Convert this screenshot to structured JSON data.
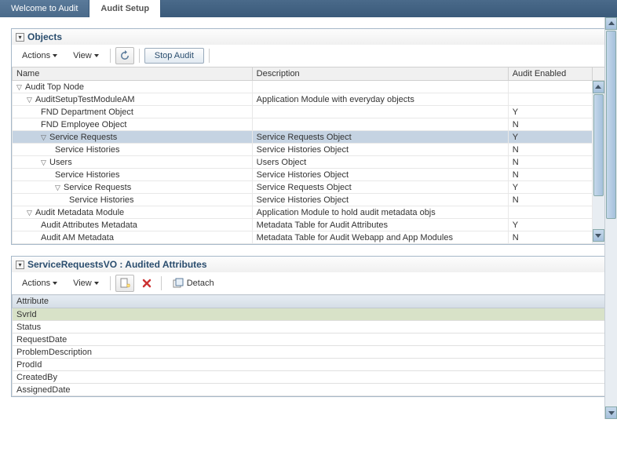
{
  "tabs": {
    "welcome": "Welcome to Audit",
    "setup": "Audit Setup"
  },
  "objects_panel": {
    "title": "Objects",
    "actions": "Actions",
    "view": "View",
    "stop_audit": "Stop Audit",
    "columns": {
      "name": "Name",
      "description": "Description",
      "audit_enabled": "Audit Enabled"
    },
    "rows": [
      {
        "indent": 0,
        "toggle": "▽",
        "name": "Audit Top Node",
        "description": "",
        "audit": ""
      },
      {
        "indent": 1,
        "toggle": "▽",
        "name": "AuditSetupTestModuleAM",
        "description": "Application Module with everyday objects",
        "audit": ""
      },
      {
        "indent": 2,
        "toggle": "",
        "name": "FND Department Object",
        "description": "",
        "audit": "Y"
      },
      {
        "indent": 2,
        "toggle": "",
        "name": "FND Employee Object",
        "description": "",
        "audit": "N"
      },
      {
        "indent": 2,
        "toggle": "▽",
        "name": "Service Requests",
        "description": "Service Requests Object",
        "audit": "Y",
        "selected": true
      },
      {
        "indent": 3,
        "toggle": "",
        "name": "Service Histories",
        "description": "Service Histories Object",
        "audit": "N"
      },
      {
        "indent": 2,
        "toggle": "▽",
        "name": "Users",
        "description": "Users Object",
        "audit": "N"
      },
      {
        "indent": 3,
        "toggle": "",
        "name": "Service Histories",
        "description": "Service Histories Object",
        "audit": "N"
      },
      {
        "indent": 3,
        "toggle": "▽",
        "name": "Service Requests",
        "description": "Service Requests Object",
        "audit": "Y"
      },
      {
        "indent": 4,
        "toggle": "",
        "name": "Service Histories",
        "description": "Service Histories Object",
        "audit": "N"
      },
      {
        "indent": 1,
        "toggle": "▽",
        "name": "Audit Metadata Module",
        "description": "Application Module to hold audit metadata objs",
        "audit": ""
      },
      {
        "indent": 2,
        "toggle": "",
        "name": "Audit Attributes Metadata",
        "description": "Metadata Table for Audit Attributes",
        "audit": "Y"
      },
      {
        "indent": 2,
        "toggle": "",
        "name": "Audit AM Metadata",
        "description": "Metadata Table for Audit Webapp and App Modules",
        "audit": "N"
      }
    ]
  },
  "attributes_panel": {
    "title": "ServiceRequestsVO : Audited Attributes",
    "actions": "Actions",
    "view": "View",
    "detach": "Detach",
    "column": "Attribute",
    "rows": [
      {
        "name": "SvrId",
        "selected": true
      },
      {
        "name": "Status"
      },
      {
        "name": "RequestDate"
      },
      {
        "name": "ProblemDescription"
      },
      {
        "name": "ProdId"
      },
      {
        "name": "CreatedBy"
      },
      {
        "name": "AssignedDate"
      }
    ]
  }
}
